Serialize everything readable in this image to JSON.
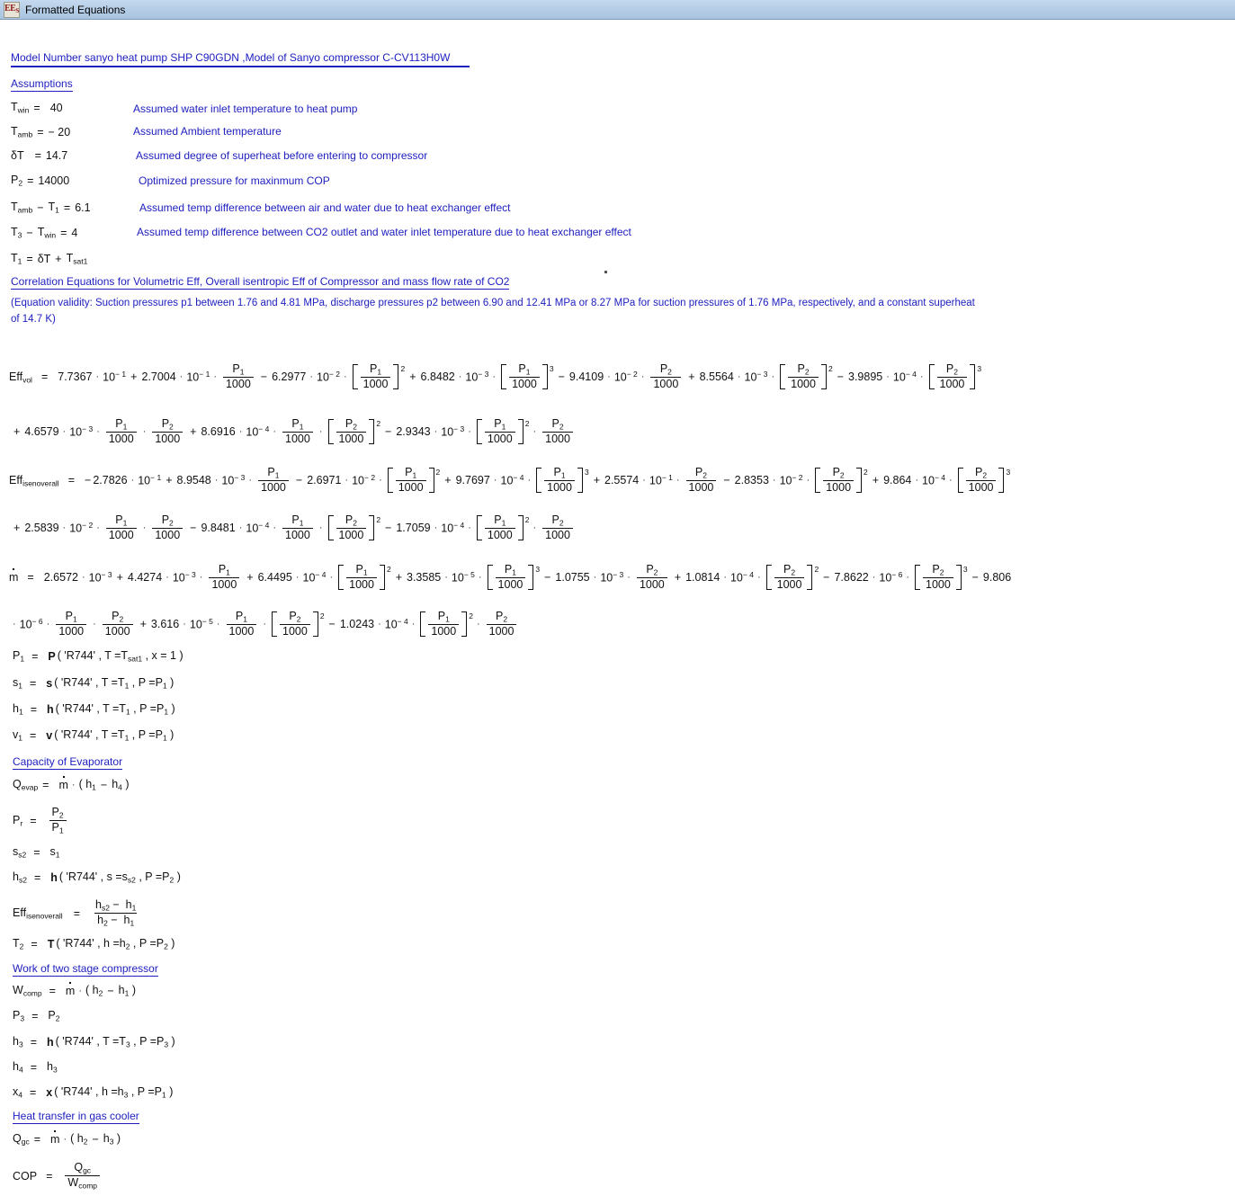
{
  "window": {
    "title": "Formatted Equations",
    "app_icon": "ees-icon",
    "icon_text": "EE",
    "icon_sub": "S"
  },
  "colors": {
    "accent_blue": "#2020c0",
    "titlebar": "#b5cde6",
    "text": "#1a1a1a"
  },
  "document": {
    "model_header": "Model Number sanyo heat pump SHP C90GDN ,Model of Sanyo compressor C-CV113H0W",
    "assumptions_header": "Assumptions",
    "assumptions": [
      {
        "lhs": "T",
        "lhs_sub": "win",
        "eq": "=",
        "value": "40",
        "note": "Assumed water inlet temperature to heat pump"
      },
      {
        "lhs": "T",
        "lhs_sub": "amb",
        "eq": "=",
        "value": "− 20",
        "note": "Assumed Ambient temperature"
      },
      {
        "lhs": "δT",
        "lhs_sub": "",
        "eq": "=",
        "value": "14.7",
        "note": "Assumed degree of superheat before entering to compressor"
      },
      {
        "lhs": "P",
        "lhs_sub": "2",
        "eq": "=",
        "value": "14000",
        "note": "Optimized pressure for maxinmum COP"
      },
      {
        "lhs": "Tamb − T1",
        "lhs_sub": "",
        "eq": "=",
        "value": "6.1",
        "note": "Assumed temp difference  between air and water due to heat exchanger effect"
      },
      {
        "lhs": "T3 − Twin",
        "lhs_sub": "",
        "eq": "=",
        "value": "4",
        "note": "Assumed temp difference between CO2 outlet and water inlet temperature due to heat exchanger effect"
      },
      {
        "lhs": "T1",
        "lhs_sub": "",
        "eq": "=",
        "value": "δT + Tsat1",
        "note": ""
      }
    ],
    "correlation_header": "Correlation Equations for Volumetric Eff, Overall isentropic Eff of Compressor and mass flow rate of CO2",
    "validity_note_line1": "(Equation validity: Suction pressures p1 between 1.76 and 4.81 MPa, discharge pressures p2 between 6.90 and 12.41 MPa  or 8.27 MPa for suction pressures of 1.76 MPa, respectively, and a constant superheat",
    "validity_note_line2": "of 14.7 K)",
    "capacity_header": "Capacity of Evaporator",
    "work_header": "Work of two stage compressor",
    "gascooler_header": "Heat transfer in gas cooler"
  },
  "equations": {
    "eff_vol": {
      "name": "Eff",
      "name_sub": "vol",
      "terms": [
        {
          "sign": "",
          "coef": "7.7367",
          "exp": "− 1",
          "vars": []
        },
        {
          "sign": "+",
          "coef": "2.7004",
          "exp": "− 1",
          "vars": [
            "P1/1000"
          ]
        },
        {
          "sign": "−",
          "coef": "6.2977",
          "exp": "− 2",
          "vars": [
            "[P1/1000]^2"
          ]
        },
        {
          "sign": "+",
          "coef": "6.8482",
          "exp": "− 3",
          "vars": [
            "[P1/1000]^3"
          ]
        },
        {
          "sign": "−",
          "coef": "9.4109",
          "exp": "− 2",
          "vars": [
            "P2/1000"
          ]
        },
        {
          "sign": "+",
          "coef": "8.5564",
          "exp": "− 3",
          "vars": [
            "[P2/1000]^2"
          ]
        },
        {
          "sign": "−",
          "coef": "3.9895",
          "exp": "− 4",
          "vars": [
            "[P2/1000]^3"
          ]
        },
        {
          "sign": "+",
          "coef": "4.6579",
          "exp": "− 3",
          "vars": [
            "P1/1000",
            "P2/1000"
          ]
        },
        {
          "sign": "+",
          "coef": "8.6916",
          "exp": "− 4",
          "vars": [
            "P1/1000",
            "[P2/1000]^2"
          ]
        },
        {
          "sign": "−",
          "coef": "2.9343",
          "exp": "− 3",
          "vars": [
            "[P1/1000]^2",
            "P2/1000"
          ]
        }
      ]
    },
    "eff_isenoverall": {
      "name": "Eff",
      "name_sub": "isenoverall",
      "terms": [
        {
          "sign": "−",
          "coef": "2.7826",
          "exp": "− 1",
          "vars": []
        },
        {
          "sign": "+",
          "coef": "8.9548",
          "exp": "− 3",
          "vars": [
            "P1/1000"
          ]
        },
        {
          "sign": "−",
          "coef": "2.6971",
          "exp": "− 2",
          "vars": [
            "[P1/1000]^2"
          ]
        },
        {
          "sign": "+",
          "coef": "9.7697",
          "exp": "− 4",
          "vars": [
            "[P1/1000]^3"
          ]
        },
        {
          "sign": "+",
          "coef": "2.5574",
          "exp": "− 1",
          "vars": [
            "P2/1000"
          ]
        },
        {
          "sign": "−",
          "coef": "2.8353",
          "exp": "− 2",
          "vars": [
            "[P2/1000]^2"
          ]
        },
        {
          "sign": "+",
          "coef": "9.864",
          "exp": "− 4",
          "vars": [
            "[P2/1000]^3"
          ]
        },
        {
          "sign": "+",
          "coef": "2.5839",
          "exp": "− 2",
          "vars": [
            "P1/1000",
            "P2/1000"
          ]
        },
        {
          "sign": "−",
          "coef": "9.8481",
          "exp": "− 4",
          "vars": [
            "P1/1000",
            "[P2/1000]^2"
          ]
        },
        {
          "sign": "−",
          "coef": "1.7059",
          "exp": "− 4",
          "vars": [
            "[P1/1000]^2",
            "P2/1000"
          ]
        }
      ]
    },
    "mdot": {
      "name": "m",
      "name_sub": "",
      "terms": [
        {
          "sign": "",
          "coef": "2.6572",
          "exp": "− 3",
          "vars": []
        },
        {
          "sign": "+",
          "coef": "4.4274",
          "exp": "− 3",
          "vars": [
            "P1/1000"
          ]
        },
        {
          "sign": "+",
          "coef": "6.4495",
          "exp": "− 4",
          "vars": [
            "[P1/1000]^2"
          ]
        },
        {
          "sign": "+",
          "coef": "3.3585",
          "exp": "− 5",
          "vars": [
            "[P1/1000]^3"
          ]
        },
        {
          "sign": "−",
          "coef": "1.0755",
          "exp": "− 3",
          "vars": [
            "P2/1000"
          ]
        },
        {
          "sign": "+",
          "coef": "1.0814",
          "exp": "− 4",
          "vars": [
            "[P2/1000]^2"
          ]
        },
        {
          "sign": "−",
          "coef": "7.8622",
          "exp": "− 6",
          "vars": [
            "[P2/1000]^3"
          ]
        },
        {
          "sign": "−",
          "coef": "9.806",
          "exp": "− 6",
          "vars": [
            "P1/1000",
            "P2/1000"
          ]
        },
        {
          "sign": "+",
          "coef": "3.616",
          "exp": "− 5",
          "vars": [
            "P1/1000",
            "[P2/1000]^2"
          ]
        },
        {
          "sign": "−",
          "coef": "1.0243",
          "exp": "− 4",
          "vars": [
            "[P1/1000]^2",
            "P2/1000"
          ]
        }
      ]
    }
  },
  "property_calls": {
    "p1": {
      "lhs": "P",
      "lhs_sub": "1",
      "fn": "P",
      "fluid": "'R744'",
      "args": "T =Tsat1 , x = 1"
    },
    "s1": {
      "lhs": "s",
      "lhs_sub": "1",
      "fn": "s",
      "fluid": "'R744'",
      "args": "T =T1 , P =P1"
    },
    "h1": {
      "lhs": "h",
      "lhs_sub": "1",
      "fn": "h",
      "fluid": "'R744'",
      "args": "T =T1 , P =P1"
    },
    "v1": {
      "lhs": "v",
      "lhs_sub": "1",
      "fn": "v",
      "fluid": "'R744'",
      "args": "T =T1 , P =P1"
    },
    "hs2": {
      "lhs": "h",
      "lhs_sub": "s2",
      "fn": "h",
      "fluid": "'R744'",
      "args": "s =ss2 , P =P2"
    },
    "t2": {
      "lhs": "T",
      "lhs_sub": "2",
      "fn": "T",
      "fluid": "'R744'",
      "args": "h =h2 , P =P2"
    },
    "h3": {
      "lhs": "h",
      "lhs_sub": "3",
      "fn": "h",
      "fluid": "'R744'",
      "args": "T =T3 , P =P3"
    },
    "x4": {
      "lhs": "x",
      "lhs_sub": "4",
      "fn": "x",
      "fluid": "'R744'",
      "args": "h =h3 , P =P1"
    }
  },
  "simple_equations": {
    "q_evap": "Qevap = ṁ · ( h1 − h4 )",
    "p_r": "Pr = P2 / P1",
    "ss2": "ss2 = s1",
    "eff_isen": "Effisenoverall = ( hs2 − h1 ) / ( h2 − h1 )",
    "w_comp": "Wcomp = ṁ · ( h2 − h1 )",
    "p3": "P3 = P2",
    "h4": "h4 = h3",
    "q_gc": "Qgc = ṁ · ( h2 − h3 )",
    "cop": "COP = Qgc / Wcomp"
  },
  "symbols": {
    "multiply_dot": "·",
    "minus": "−",
    "plus": "+",
    "equals": "=",
    "ten": "10",
    "thousand": "1000"
  }
}
